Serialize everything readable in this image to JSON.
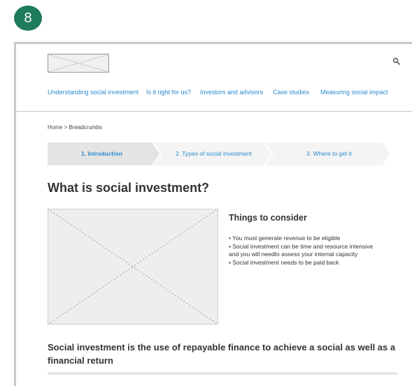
{
  "badge": {
    "number": "8"
  },
  "header": {
    "nav": [
      "Understanding social investment",
      "Is it right for us?",
      "Investors and advisors",
      "Case studies",
      "Measuring social impact"
    ]
  },
  "breadcrumb": {
    "text": "Home  >  Breadcrumbs"
  },
  "stepper": {
    "steps": [
      "1. Introduction",
      "2. Types of social investment",
      "3. Where to get it"
    ],
    "active_index": 0
  },
  "main": {
    "title": "What is social investment?",
    "considerations": {
      "heading": "Things to consider",
      "items": [
        "•  You must generate revenue to be eligible",
        "•  Social investment can be time and resource intensive and you will needto assess your internal capacity",
        "•  Social investment needs to be paid back"
      ]
    },
    "subheading": "Social investment is the use of repayable finance to achieve a social as well as a financial return"
  },
  "colors": {
    "badge": "#1e7b5b",
    "link": "#2a8bd0",
    "active_step_bg": "#e4e4e4",
    "step_bg": "#f4f4f4"
  },
  "icons": {
    "search": "search-icon",
    "logo": "logo-placeholder",
    "image": "image-placeholder"
  }
}
